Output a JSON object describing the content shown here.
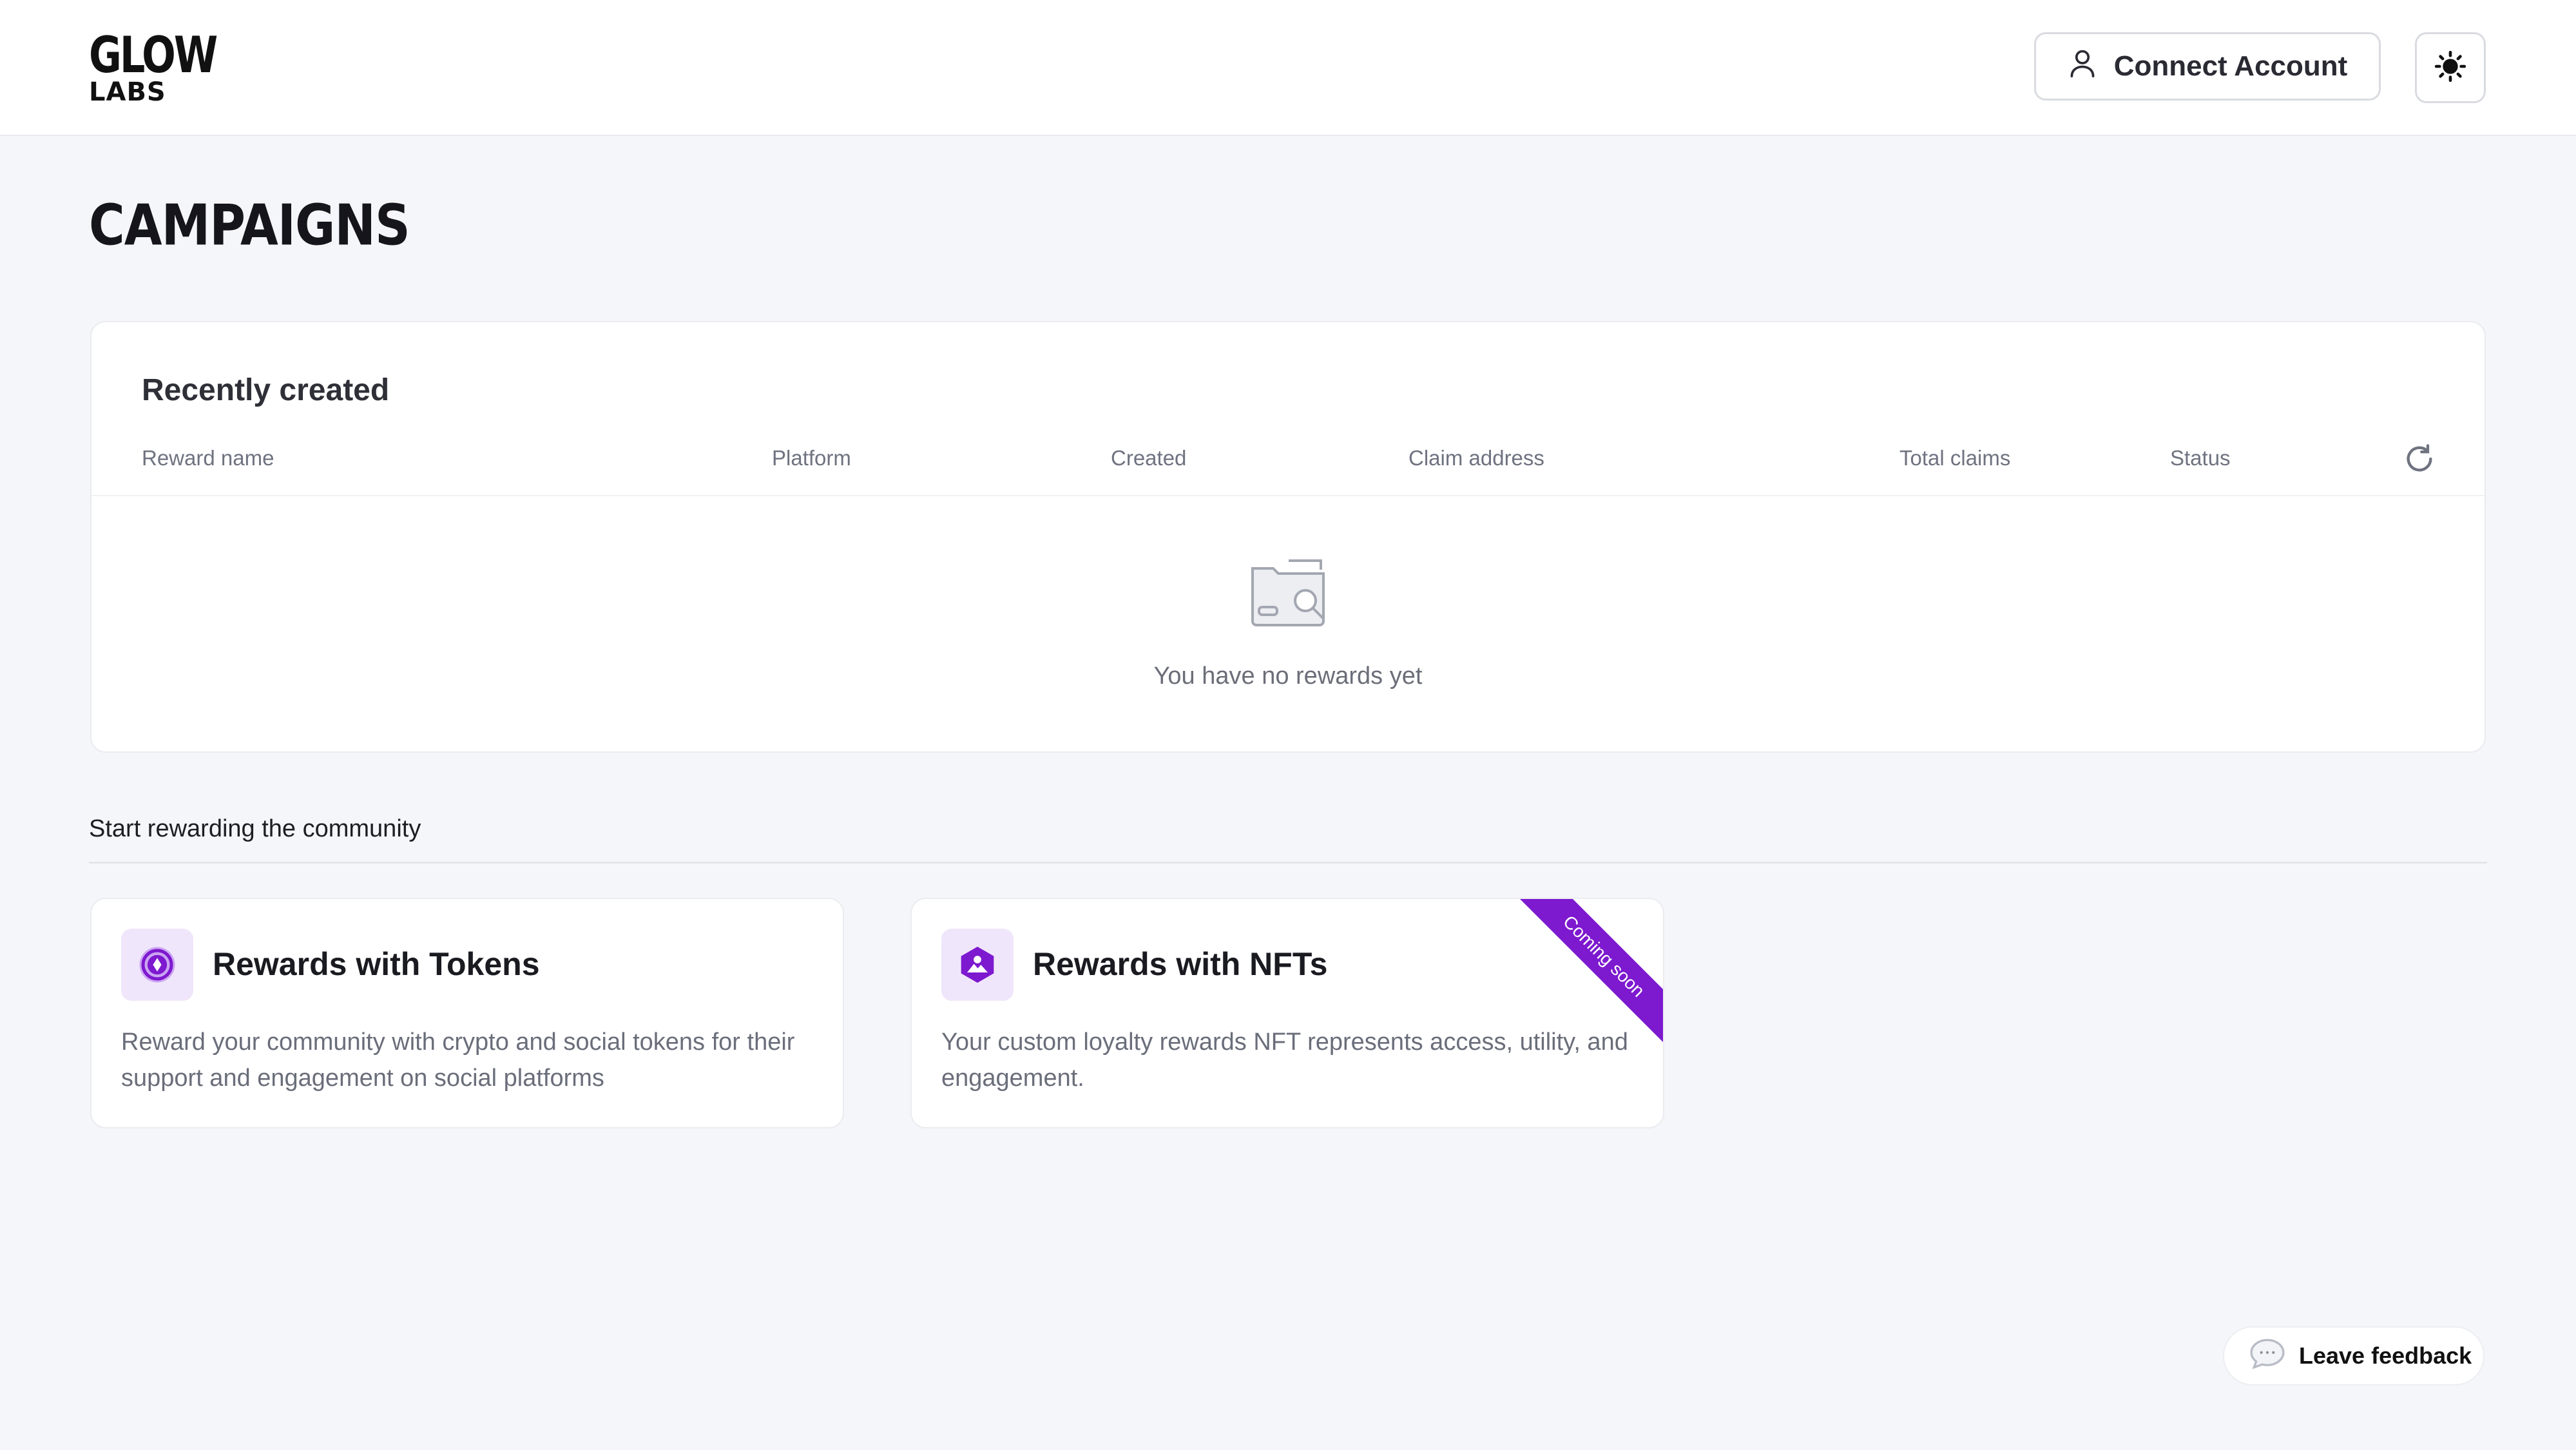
{
  "header": {
    "logo_line1": "GLOW",
    "logo_line2": "LABS",
    "connect_label": "Connect Account"
  },
  "page": {
    "title": "CAMPAIGNS"
  },
  "recent": {
    "title": "Recently created",
    "columns": [
      "Reward name",
      "Platform",
      "Created",
      "Claim address",
      "Total claims",
      "Status"
    ],
    "empty_text": "You have no rewards yet"
  },
  "community": {
    "label": "Start rewarding the community",
    "cards": [
      {
        "title": "Rewards with Tokens",
        "description": "Reward your community with crypto and social tokens for their support and engagement on social platforms",
        "icon": "tokens-icon"
      },
      {
        "title": "Rewards with NFTs",
        "description": "Your custom loyalty rewards NFT represents access, utility, and engagement.",
        "icon": "nft-icon",
        "ribbon": "Coming soon"
      }
    ]
  },
  "feedback": {
    "label": "Leave feedback"
  },
  "colors": {
    "accent": "#7d19cf",
    "icon_bg": "#f0e6fb"
  }
}
